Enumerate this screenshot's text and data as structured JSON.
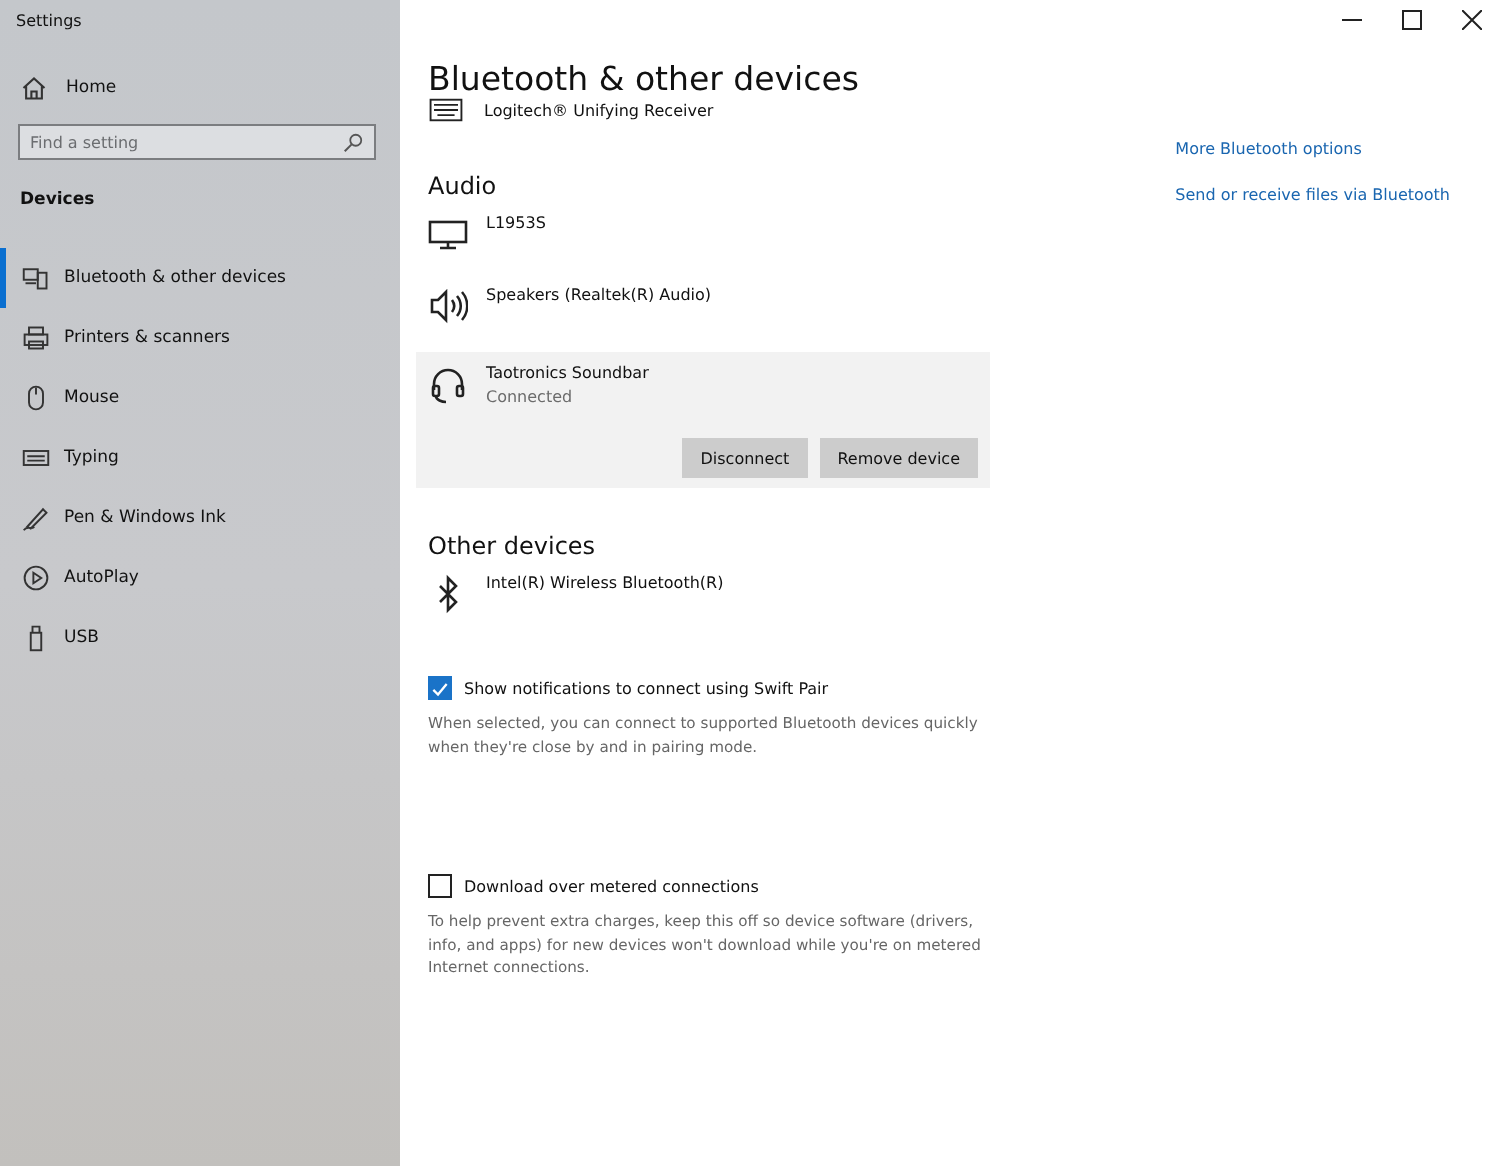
{
  "window": {
    "title": "Settings"
  },
  "sidebar": {
    "home": "Home",
    "search": {
      "placeholder": "Find a setting"
    },
    "section": "Devices",
    "items": [
      {
        "label": "Bluetooth & other devices",
        "kind": "devices",
        "selected": true
      },
      {
        "label": "Printers & scanners",
        "kind": "printer",
        "selected": false
      },
      {
        "label": "Mouse",
        "kind": "mouse",
        "selected": false
      },
      {
        "label": "Typing",
        "kind": "keyboard",
        "selected": false
      },
      {
        "label": "Pen & Windows Ink",
        "kind": "pen",
        "selected": false
      },
      {
        "label": "AutoPlay",
        "kind": "autoplay",
        "selected": false
      },
      {
        "label": "USB",
        "kind": "usb",
        "selected": false
      }
    ]
  },
  "page": {
    "title": "Bluetooth & other devices",
    "top_devices": [
      {
        "name": "Logitech® Unifying Receiver"
      }
    ],
    "groups": [
      {
        "heading": "Audio",
        "devices": [
          {
            "name": "L1953S",
            "kind": "monitor",
            "selected": false
          },
          {
            "name": "Speakers (Realtek(R) Audio)",
            "kind": "speaker",
            "selected": false
          },
          {
            "name": "Taotronics Soundbar",
            "status": "Connected",
            "kind": "headphones",
            "selected": true,
            "buttons": [
              "Disconnect",
              "Remove device"
            ]
          }
        ]
      },
      {
        "heading": "Other devices",
        "devices": [
          {
            "name": "Intel(R) Wireless Bluetooth(R)",
            "kind": "bluetooth",
            "selected": false
          }
        ]
      }
    ],
    "options": [
      {
        "label": "Show notifications to connect using Swift Pair",
        "checked": true,
        "description": "When selected, you can connect to supported Bluetooth devices quickly when they're close by and in pairing mode."
      },
      {
        "label": "Download over metered connections",
        "checked": false,
        "description": "To help prevent extra charges, keep this off so device software (drivers, info, and apps) for new devices won't download while you're on metered Internet connections."
      }
    ],
    "related_links": [
      "More Bluetooth options",
      "Send or receive files via Bluetooth"
    ]
  }
}
